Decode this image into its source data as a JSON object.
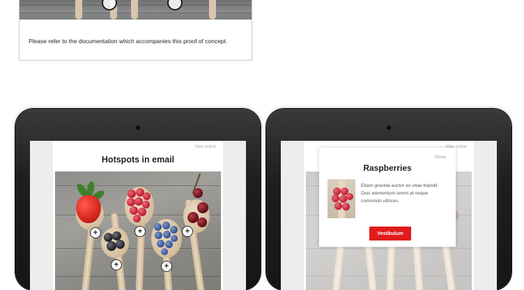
{
  "top_card": {
    "note": "Please refer to the documentation which accompanies this proof of concept."
  },
  "email": {
    "view_online": "View online",
    "title": "Hotspots in email"
  },
  "hotspots": {
    "glyph": "+"
  },
  "popup": {
    "close": "Close",
    "title": "Raspberries",
    "body": "Etiam gravida auctor ex vitae blandit. Duis elementum lorem at neque commodo ultrices.",
    "button": "Vestibulum"
  },
  "colors": {
    "button": "#e01b1b",
    "tablet_bezel": "#1e1e1e"
  },
  "icons": [
    "plus-icon",
    "camera-icon"
  ]
}
